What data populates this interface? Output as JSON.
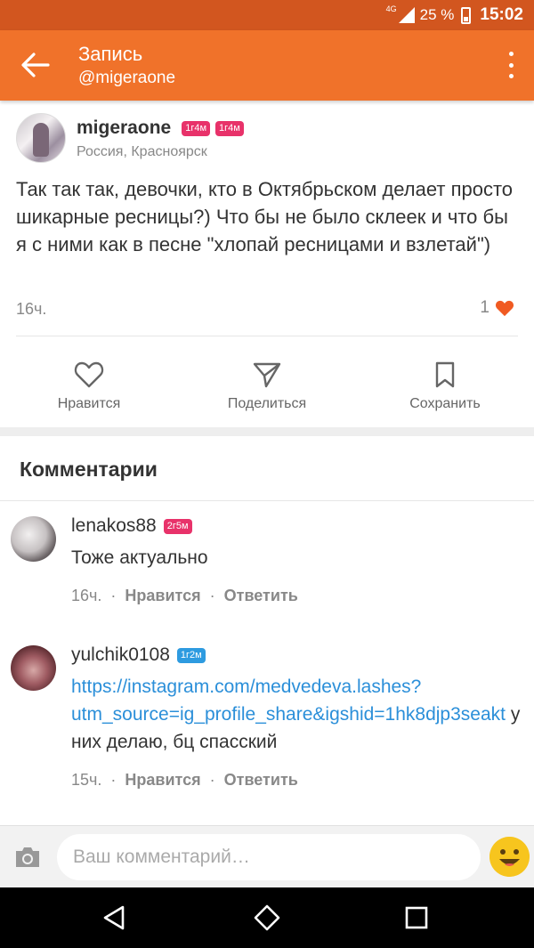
{
  "status_bar": {
    "network": "4G",
    "battery": "25 %",
    "time": "15:02"
  },
  "app_bar": {
    "title": "Запись",
    "subtitle": "@migeraone"
  },
  "post": {
    "author": "migeraone",
    "badges": [
      "1г4м",
      "1г4м"
    ],
    "location": "Россия, Красноярск",
    "text": "Так так так, девочки, кто в Октябрьском делает просто шикарные ресницы?) Что бы не было склеек и что бы я с ними как в песне \"хлопай ресницами и взлетай\")",
    "time": "16ч.",
    "likes": "1"
  },
  "actions": {
    "like": "Нравится",
    "share": "Поделиться",
    "save": "Сохранить"
  },
  "comments_title": "Комментарии",
  "comments": [
    {
      "author": "lenakos88",
      "badge": "2г5м",
      "text": "Тоже актуально",
      "time": "16ч.",
      "like": "Нравится",
      "reply": "Ответить"
    },
    {
      "author": "yulchik0108",
      "badge": "1г2м",
      "link": "https://instagram.com/medvedeva.lashes?utm_source=ig_profile_share&igshid=1hk8djp3seakt",
      "text_after": " у них делаю, бц спасский",
      "time": "15ч.",
      "like": "Нравится",
      "reply": "Ответить"
    }
  ],
  "comment_input": {
    "placeholder": "Ваш комментарий…"
  },
  "colors": {
    "accent": "#f0722a",
    "status_bar": "#d2561f",
    "badge_pink": "#e8326a",
    "badge_blue": "#2e9be0",
    "link": "#2b8fd9",
    "heart": "#f05a22"
  }
}
